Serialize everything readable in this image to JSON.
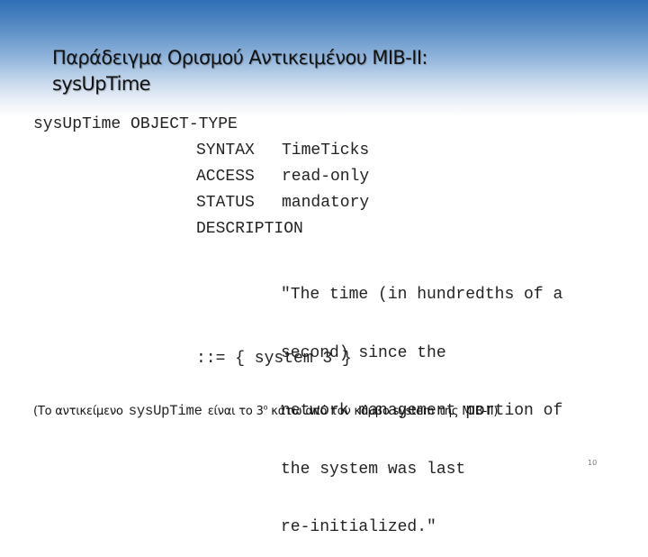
{
  "slide": {
    "title_line1": "Παράδειγμα Ορισμού Αντικειμένου MIB-II:",
    "title_line2": "sysUpTime",
    "code": {
      "header": "sysUpTime OBJECT-TYPE",
      "fields": [
        {
          "key": "SYNTAX",
          "value": "TimeTicks"
        },
        {
          "key": "ACCESS",
          "value": "read-only"
        },
        {
          "key": "STATUS",
          "value": "mandatory"
        },
        {
          "key": "DESCRIPTION",
          "value": ""
        }
      ],
      "description_lines": [
        "\"The time (in hundredths of a",
        "second) since the",
        "network management portion of",
        "the system was last",
        "re-initialized.\""
      ],
      "assignment": "::= { system 3 }"
    },
    "note": {
      "prefix": "(Το αντικείμενο",
      "object": "sysUpTime",
      "middle": "είναι το 3",
      "ordinal": "ο",
      "suffix": " κάτω από τον κόμβο system της MIB-II)"
    },
    "page_number": "10"
  }
}
